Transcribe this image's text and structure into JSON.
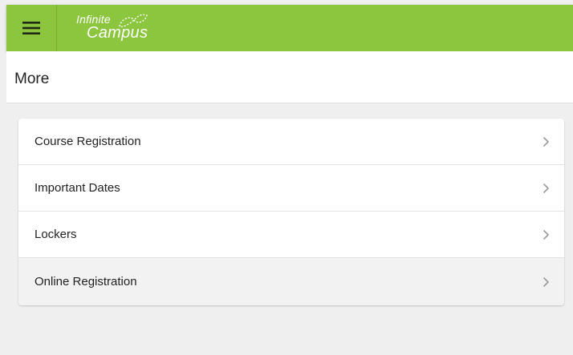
{
  "header": {
    "menu_icon": "hamburger-menu-icon",
    "logo": {
      "line1": "Infinite",
      "line2": "Campus"
    },
    "colors": {
      "bar": "#8cc63f",
      "text": "#ffffff"
    }
  },
  "page": {
    "title": "More"
  },
  "menu": {
    "items": [
      {
        "label": "Course Registration",
        "icon": "chevron-right-icon"
      },
      {
        "label": "Important Dates",
        "icon": "chevron-right-icon"
      },
      {
        "label": "Lockers",
        "icon": "chevron-right-icon"
      },
      {
        "label": "Online Registration",
        "icon": "chevron-right-icon",
        "highlighted": true
      }
    ]
  }
}
